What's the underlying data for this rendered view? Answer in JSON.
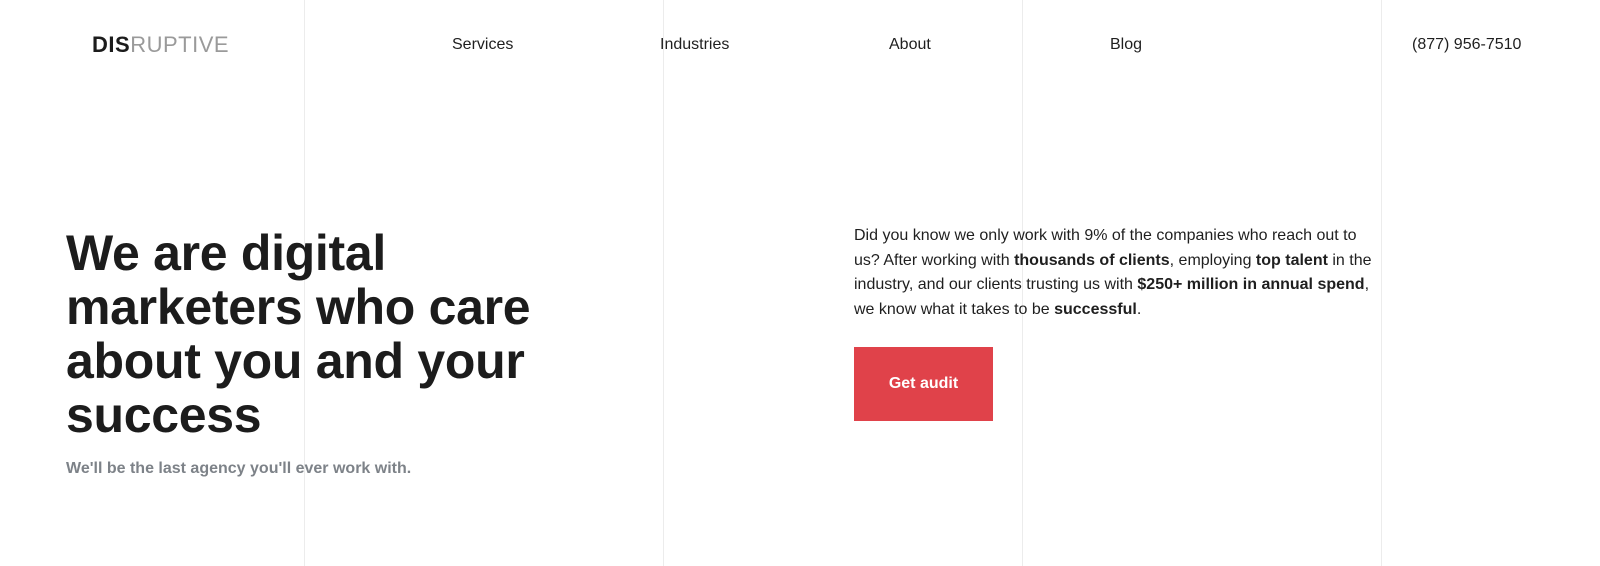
{
  "header": {
    "logo": {
      "dark_part": "DIS",
      "light_part": "RUPTIVE"
    },
    "nav": {
      "items": [
        {
          "label": "Services"
        },
        {
          "label": "Industries"
        },
        {
          "label": "About"
        },
        {
          "label": "Blog"
        }
      ]
    },
    "phone": "(877) 956-7510"
  },
  "hero": {
    "title": "We are digital marketers who care about you and your success",
    "subtitle": "We'll be the last agency you'll ever work with."
  },
  "intro": {
    "segments": [
      "Did you know we only work with 9% of the companies who reach out to us? After working with ",
      "thousands of clients",
      ", employing ",
      "top talent",
      " in the industry, and our clients trusting us with ",
      "$250+ million in annual spend",
      ", we know what it takes to be ",
      "successful",
      "."
    ],
    "cta_label": "Get audit"
  },
  "colors": {
    "accent": "#e0424a",
    "text": "#1f1f1f",
    "muted": "#7d8288",
    "grid_line": "#ececec",
    "logo_light": "#9a9a9a"
  }
}
